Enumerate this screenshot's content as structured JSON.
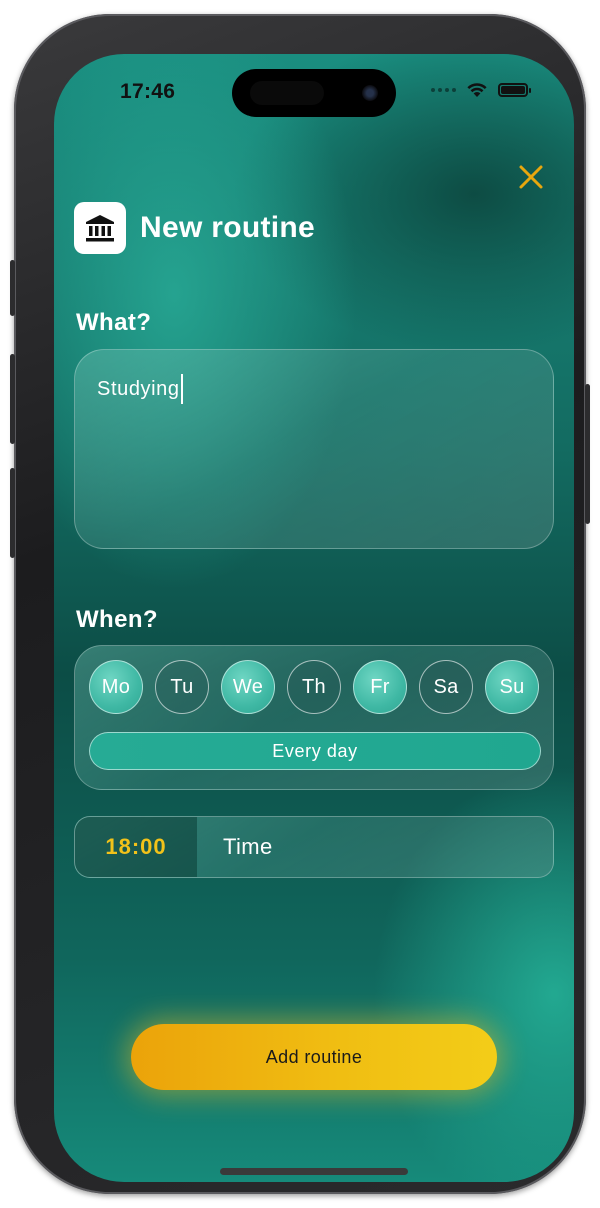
{
  "status_bar": {
    "time": "17:46",
    "icons": [
      "signal-dots-icon",
      "wifi-icon",
      "battery-icon"
    ]
  },
  "header": {
    "title": "New routine",
    "app_icon": "bank-icon",
    "close_icon": "close-icon"
  },
  "what": {
    "label": "What?",
    "value": "Studying"
  },
  "when": {
    "label": "When?",
    "days": [
      {
        "label": "Mo",
        "selected": true
      },
      {
        "label": "Tu",
        "selected": false
      },
      {
        "label": "We",
        "selected": true
      },
      {
        "label": "Th",
        "selected": false
      },
      {
        "label": "Fr",
        "selected": true
      },
      {
        "label": "Sa",
        "selected": false
      },
      {
        "label": "Su",
        "selected": true
      }
    ],
    "every_day_label": "Every day"
  },
  "time_field": {
    "value": "18:00",
    "label": "Time"
  },
  "actions": {
    "add_label": "Add routine"
  },
  "colors": {
    "accent": "#F0BD12",
    "time_text": "#F2C21A",
    "close_icon": "#E8A70E",
    "day_selected": "#3FB8A4",
    "background_teal": "#136B61"
  }
}
